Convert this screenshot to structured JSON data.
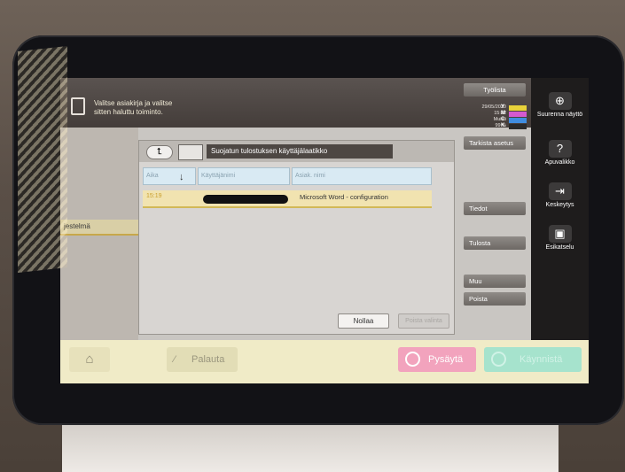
{
  "header": {
    "instruction_line1": "Valitse asiakirja ja valitse",
    "instruction_line2": "sitten haluttu toiminto.",
    "date": "29/05/2020",
    "time": "15:22",
    "memory_label": "Muisti",
    "memory_value": "99 %",
    "toner_labels": [
      "Y",
      "M",
      "C",
      "K"
    ],
    "toner_colors": [
      "#e8d23a",
      "#d45ad0",
      "#3f8de0",
      "#2a2a2a"
    ]
  },
  "left_panel": {
    "selected_item": "jestelmä"
  },
  "dialog": {
    "title": "Suojatun tulostuksen käyttäjälaatikko",
    "columns": [
      "Aika",
      "Käyttäjänimi",
      "Asiak. nimi"
    ],
    "rows": [
      {
        "time": "15:19",
        "user": "",
        "document": "Microsoft Word - configuration"
      }
    ],
    "reset_button": "Nollaa",
    "disabled_button": "Poista valinta"
  },
  "right_buttons": {
    "work_list": "Työlista",
    "check_settings": "Tarkista asetus",
    "details": "Tiedot",
    "print": "Tulosta",
    "other": "Muu",
    "delete": "Poista"
  },
  "side_panel": {
    "zoom": "Suurenna näyttö",
    "help": "Apuvalikko",
    "interrupt": "Keskeytys",
    "preview": "Esikatselu"
  },
  "bottom_bar": {
    "reset": "Palauta",
    "stop": "Pysäytä",
    "start": "Käynnistä"
  }
}
